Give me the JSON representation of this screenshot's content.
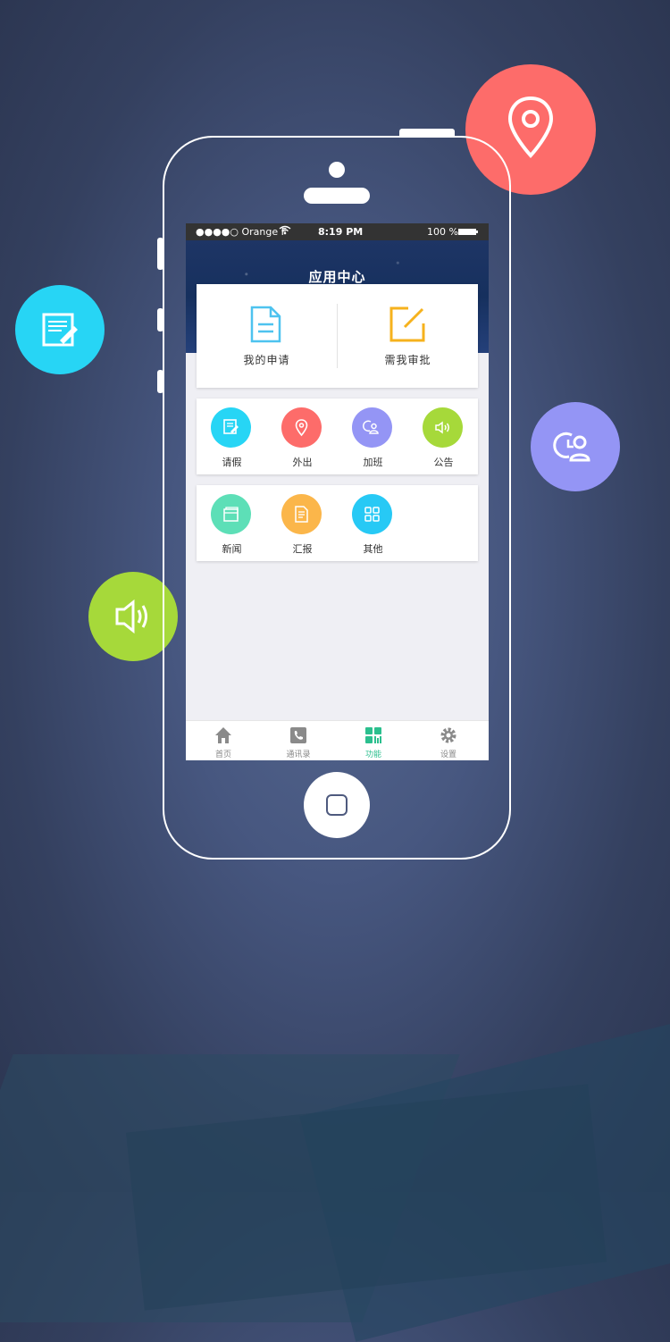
{
  "status_bar": {
    "carrier": "●●●●○ Orange F",
    "time": "8:19 PM",
    "battery": "100 %"
  },
  "header": {
    "title": "应用中心"
  },
  "main_actions": [
    {
      "label": "我的申请",
      "icon": "document-icon",
      "color": "#4ec3ef"
    },
    {
      "label": "需我审批",
      "icon": "edit-icon",
      "color": "#f6b21d"
    }
  ],
  "grid_row1": [
    {
      "label": "请假",
      "icon": "leave-form-icon",
      "color": "#27d5f5"
    },
    {
      "label": "外出",
      "icon": "location-icon",
      "color": "#fd6c6a"
    },
    {
      "label": "加班",
      "icon": "overtime-icon",
      "color": "#9495f5"
    },
    {
      "label": "公告",
      "icon": "speaker-icon",
      "color": "#a6d93a"
    }
  ],
  "grid_row2": [
    {
      "label": "新闻",
      "icon": "news-icon",
      "color": "#5ddfb7"
    },
    {
      "label": "汇报",
      "icon": "report-icon",
      "color": "#fbb64a"
    },
    {
      "label": "其他",
      "icon": "grid-icon",
      "color": "#27c9f5"
    }
  ],
  "tabbar": [
    {
      "label": "首页",
      "icon": "home-icon",
      "active": false
    },
    {
      "label": "通讯录",
      "icon": "contacts-icon",
      "active": false
    },
    {
      "label": "功能",
      "icon": "apps-icon",
      "active": true
    },
    {
      "label": "设置",
      "icon": "gear-icon",
      "active": false
    }
  ],
  "colors": {
    "accent_green": "#2bbf8e",
    "float_location": "#fd6c6a",
    "float_document": "#27d5f5",
    "float_person": "#9495f5",
    "float_speaker": "#a6d93a"
  }
}
